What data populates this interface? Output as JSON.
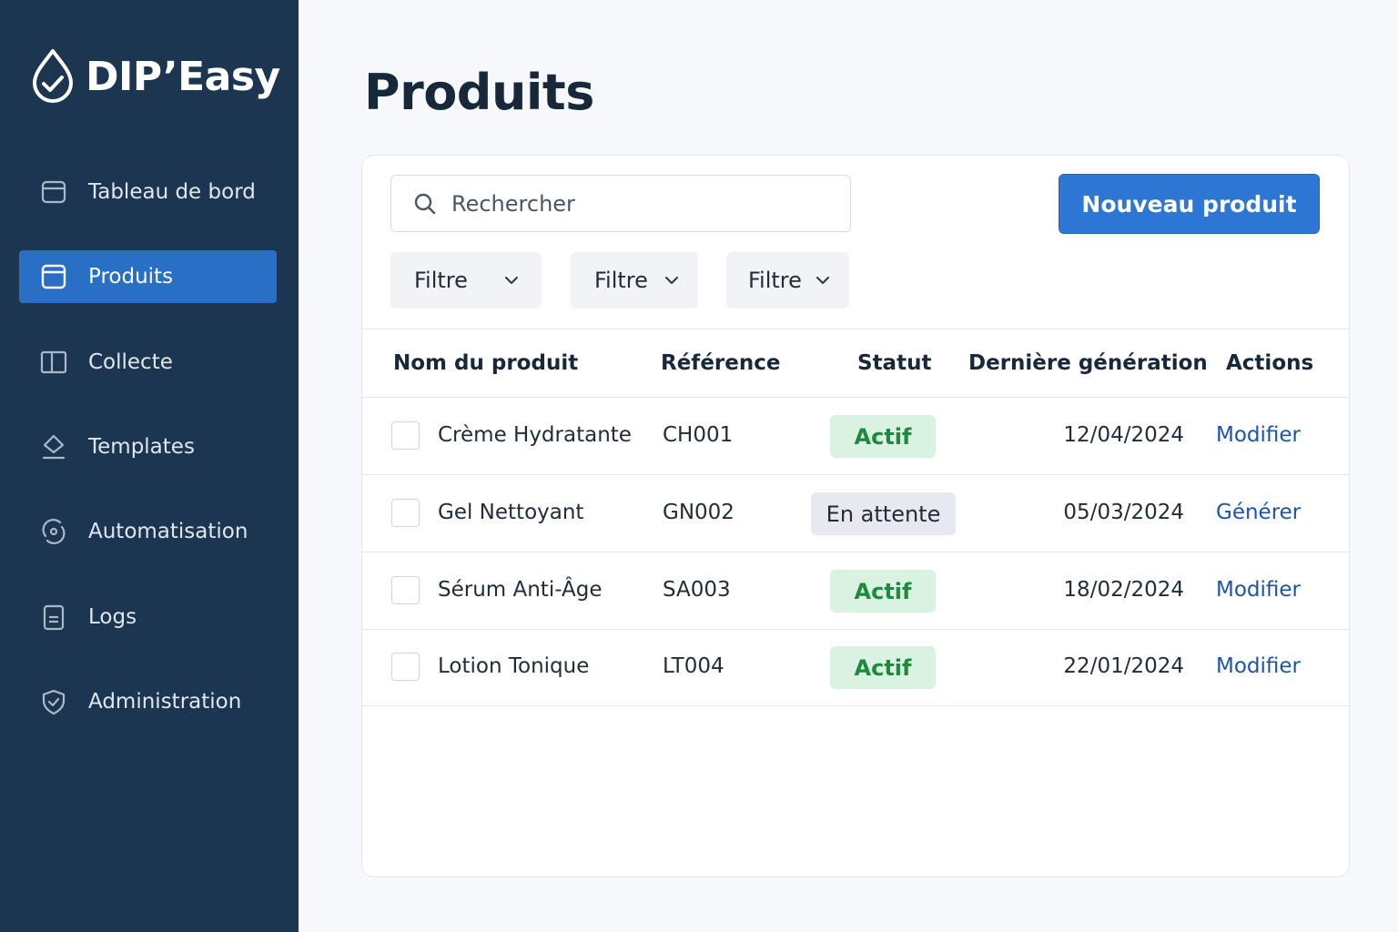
{
  "app": {
    "name": "DIP’Easy"
  },
  "sidebar": {
    "items": [
      {
        "label": "Tableau de bord",
        "icon": "dashboard-icon",
        "active": false
      },
      {
        "label": "Produits",
        "icon": "products-icon",
        "active": true
      },
      {
        "label": "Collecte",
        "icon": "book-icon",
        "active": false
      },
      {
        "label": "Templates",
        "icon": "template-icon",
        "active": false
      },
      {
        "label": "Automatisation",
        "icon": "automation-icon",
        "active": false
      },
      {
        "label": "Logs",
        "icon": "logs-icon",
        "active": false
      },
      {
        "label": "Administration",
        "icon": "shield-icon",
        "active": false
      }
    ]
  },
  "page": {
    "title": "Produits"
  },
  "toolbar": {
    "search_placeholder": "Rechercher",
    "new_button": "Nouveau produit",
    "filters": [
      "Filtre",
      "Filtre",
      "Filtre"
    ]
  },
  "table": {
    "columns": [
      "Nom du produit",
      "Référence",
      "Statut",
      "Dernière génération",
      "Actions"
    ],
    "rows": [
      {
        "name": "Crème Hydratante",
        "ref": "CH001",
        "status": "Actif",
        "date": "12/04/2024",
        "action": "Modifier"
      },
      {
        "name": "Gel Nettoyant",
        "ref": "GN002",
        "status": "En attente",
        "date": "05/03/2024",
        "action": "Générer"
      },
      {
        "name": "Sérum Anti-Âge",
        "ref": "SA003",
        "status": "Actif",
        "date": "18/02/2024",
        "action": "Modifier"
      },
      {
        "name": "Lotion Tonique",
        "ref": "LT004",
        "status": "Actif",
        "date": "22/01/2024",
        "action": "Modifier"
      }
    ]
  },
  "colors": {
    "sidebar_bg": "#1c3651",
    "accent": "#2e76d3",
    "status_active_bg": "#d9f2e2",
    "status_active_text": "#1d8a3c",
    "status_pending_bg": "#e8e8f1",
    "link": "#1d55a6"
  }
}
